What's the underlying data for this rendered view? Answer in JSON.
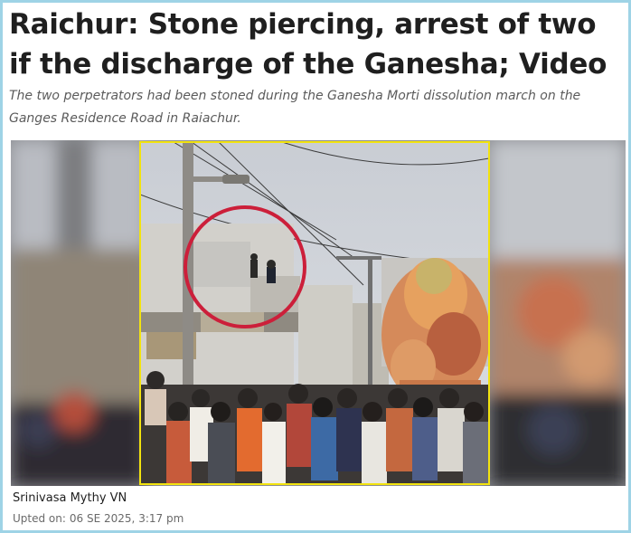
{
  "article": {
    "headline": "Raichur: Stone piercing, arrest of two if the discharge of the Ganesha; Video",
    "subtitle": "The two perpetrators had been stoned during the Ganesha Morti dissolution march on the Ganges Residence Road in Raiachur.",
    "author": "Srinivasa Mythy VN",
    "updated_label": "Upted on:",
    "updated_value": "06 SE 2025, 3:17 pm"
  },
  "media": {
    "highlight_color": "#f2e30f",
    "circle_color": "#cc1f3a"
  }
}
